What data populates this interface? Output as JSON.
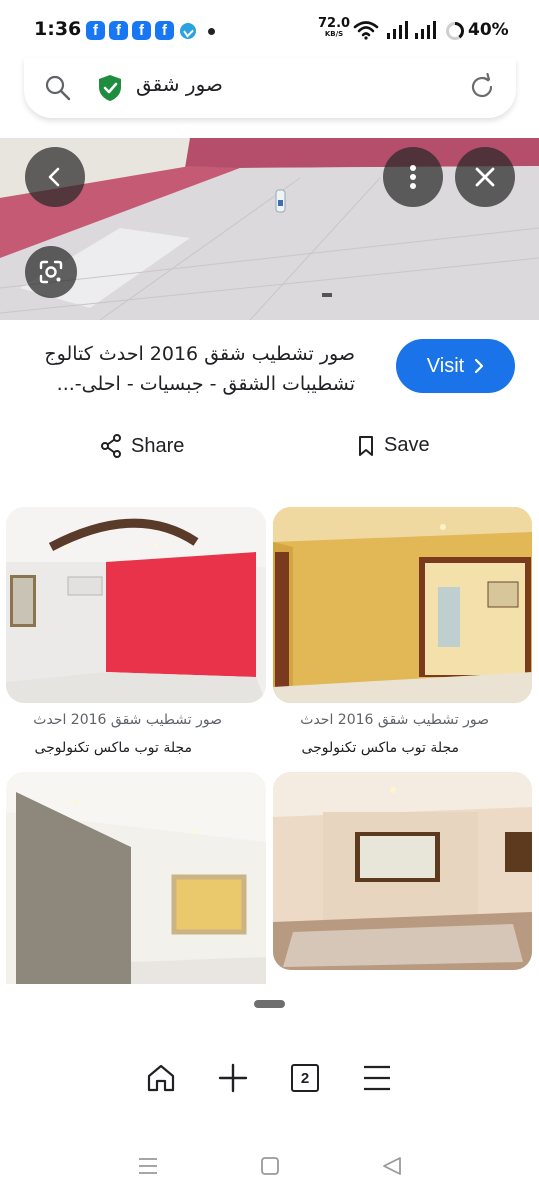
{
  "status": {
    "time": "1:36",
    "net_speed": "72.0",
    "net_unit": "KB/S",
    "battery": "40%",
    "notifications": [
      "facebook-icon",
      "facebook-icon",
      "facebook-icon",
      "facebook-icon",
      "telegram-icon",
      "dot-icon"
    ]
  },
  "search": {
    "query": "صور شقق",
    "secure_color": "#1e8e3e"
  },
  "result": {
    "title_line1": "صور تشطيب شقق 2016 احدث كتالوج",
    "title_line2": "تشطيبات الشقق - جبسيات - احلى-...",
    "visit_label": "Visit",
    "share_label": "Share",
    "save_label": "Save"
  },
  "related": [
    {
      "caption": "صور تشطيب شقق 2016 احدث",
      "source": "مجلة توب ماكس تكنولوجى"
    },
    {
      "caption": "صور تشطيب شقق 2016 احدث",
      "source": "مجلة توب ماكس تكنولوجى"
    },
    {
      "caption": "",
      "source": ""
    },
    {
      "caption": "",
      "source": ""
    }
  ],
  "toolbar": {
    "tab_count": "2"
  },
  "colors": {
    "accent": "#1a73e8"
  }
}
